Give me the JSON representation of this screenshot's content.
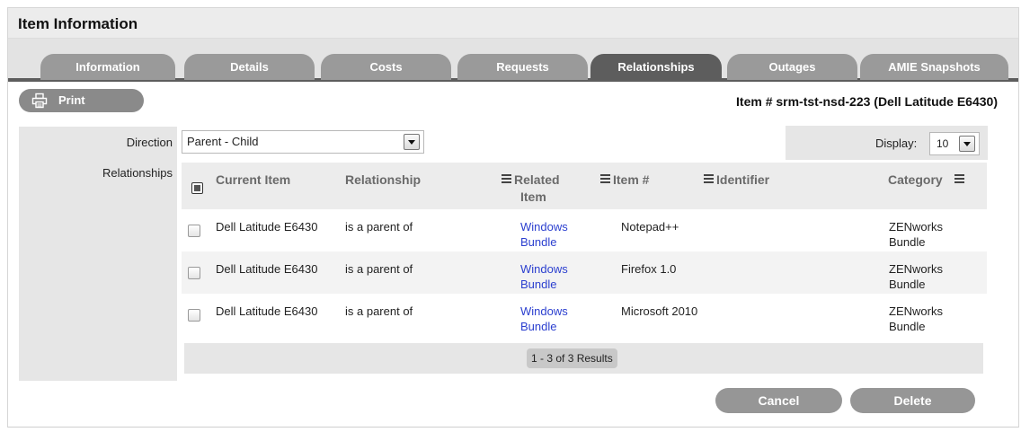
{
  "page": {
    "title": "Item Information"
  },
  "tabs": [
    {
      "label": "Information",
      "active": false
    },
    {
      "label": "Details",
      "active": false
    },
    {
      "label": "Costs",
      "active": false
    },
    {
      "label": "Requests",
      "active": false
    },
    {
      "label": "Relationships",
      "active": true
    },
    {
      "label": "Outages",
      "active": false
    },
    {
      "label": "AMIE Snapshots",
      "active": false
    }
  ],
  "toolbar": {
    "print_label": "Print",
    "print_icon": "printer-icon"
  },
  "item_heading": "Item # srm-tst-nsd-223 (Dell Latitude E6430)",
  "form": {
    "direction_label": "Direction",
    "direction_value": "Parent - Child",
    "relationships_label": "Relationships",
    "display_label": "Display:",
    "display_value": "10"
  },
  "table": {
    "columns": {
      "current_item": "Current Item",
      "relationship": "Relationship",
      "related_item_1": "Related",
      "related_item_2": "Item",
      "item_number": "Item #",
      "identifier": "Identifier",
      "category": "Category"
    },
    "rows": [
      {
        "current_item": "Dell Latitude E6430",
        "relationship": "is a parent of",
        "related_1": "Windows",
        "related_2": "Bundle",
        "item_number": "Notepad++",
        "identifier": "",
        "category_1": "ZENworks",
        "category_2": "Bundle"
      },
      {
        "current_item": "Dell Latitude E6430",
        "relationship": "is a parent of",
        "related_1": "Windows",
        "related_2": "Bundle",
        "item_number": "Firefox 1.0",
        "identifier": "",
        "category_1": "ZENworks",
        "category_2": "Bundle"
      },
      {
        "current_item": "Dell Latitude E6430",
        "relationship": "is a parent of",
        "related_1": "Windows",
        "related_2": "Bundle",
        "item_number": "Microsoft 2010",
        "identifier": "",
        "category_1": "ZENworks",
        "category_2": "Bundle"
      }
    ],
    "pager_text": "1 - 3 of 3 Results"
  },
  "actions": {
    "cancel_label": "Cancel",
    "delete_label": "Delete"
  },
  "colors": {
    "active_tab": "#5d5d5d",
    "inactive_tab": "#9a9a9a",
    "link": "#2b3fcf",
    "button": "#969696"
  }
}
